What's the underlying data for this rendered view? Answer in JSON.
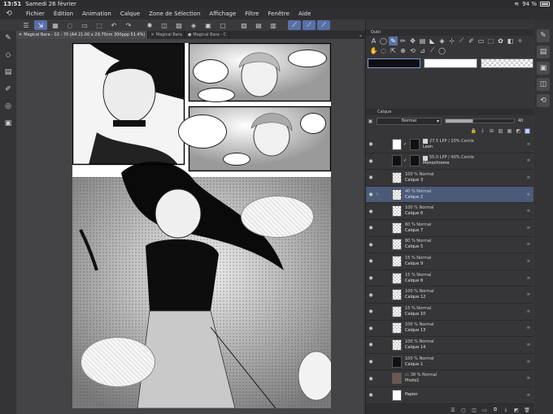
{
  "status": {
    "time": "13:51",
    "date": "Samedi 26 février",
    "battery": "94 %"
  },
  "menubar": {
    "items": [
      {
        "label": "Fichier"
      },
      {
        "label": "Édition"
      },
      {
        "label": "Animation"
      },
      {
        "label": "Calque"
      },
      {
        "label": "Zone de Sélection"
      },
      {
        "label": "Affichage"
      },
      {
        "label": "Filtre"
      },
      {
        "label": "Fenêtre"
      },
      {
        "label": "Aide"
      }
    ]
  },
  "tabs": [
    {
      "label": "Magical Bara - 02 - 70 (A4 21.00 x 29.70cm 300ppp 51.4%)"
    },
    {
      "label": "Magical Bara"
    },
    {
      "label": "Magical Bara - C"
    }
  ],
  "tool_panel": {
    "title": "Outil"
  },
  "colors": {
    "main": "#0e0e10",
    "sub": "#ffffff",
    "accent": "#5870a8",
    "selected_layer": "#4c5a7a"
  },
  "layer_panel": {
    "title": "Calque",
    "blend_mode": "Normal",
    "opacity": "40",
    "layers": [
      {
        "blend": "27.5 LPP / 20% Cercle",
        "name": "Leon",
        "thumb": "white",
        "mask": true,
        "clip": true,
        "tone": true
      },
      {
        "blend": "55.0 LPP / 40% Cercle",
        "name": "Monochrome",
        "thumb": "dark",
        "mask": true,
        "clip": true,
        "tone": true
      },
      {
        "blend": "100 %  Normal",
        "name": "Calque 3",
        "thumb": "transparent"
      },
      {
        "blend": "40 %  Normal",
        "name": "Calque 2",
        "thumb": "transparent",
        "selected": true,
        "pen": true
      },
      {
        "blend": "100 %  Normal",
        "name": "Calque 6",
        "thumb": "transparent"
      },
      {
        "blend": "60 %  Normal",
        "name": "Calque 7",
        "thumb": "transparent"
      },
      {
        "blend": "80 %  Normal",
        "name": "Calque 5",
        "thumb": "transparent"
      },
      {
        "blend": "15 %  Normal",
        "name": "Calque 9",
        "thumb": "transparent"
      },
      {
        "blend": "15 %  Normal",
        "name": "Calque 8",
        "thumb": "transparent"
      },
      {
        "blend": "100 %  Normal",
        "name": "Calque 12",
        "thumb": "transparent"
      },
      {
        "blend": "15 %  Normal",
        "name": "Calque 10",
        "thumb": "transparent"
      },
      {
        "blend": "100 %  Normal",
        "name": "Calque 13",
        "thumb": "transparent"
      },
      {
        "blend": "100 %  Normal",
        "name": "Calque 14",
        "thumb": "transparent"
      },
      {
        "blend": "100 %  Normal",
        "name": "Calque 1",
        "thumb": "dark"
      },
      {
        "blend": "38 %  Normal",
        "name": "Photo1",
        "thumb": "photo",
        "folder": true
      },
      {
        "blend": "",
        "name": "Papier",
        "thumb": "white"
      }
    ]
  }
}
